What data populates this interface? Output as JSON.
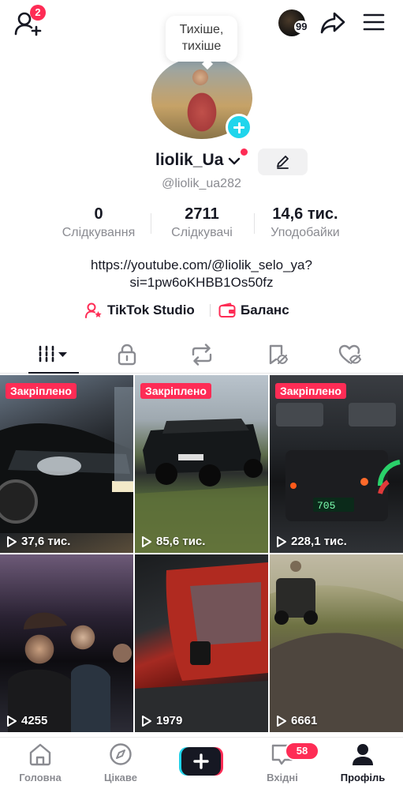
{
  "topbar": {
    "add_friends_badge": "2",
    "story_count": "99"
  },
  "avatar_bubble": {
    "line1": "Тихіше,",
    "line2": "тихіше"
  },
  "profile": {
    "username": "liolik_Ua",
    "handle": "@liolik_ua282"
  },
  "stats": [
    {
      "value": "0",
      "label": "Слідкування"
    },
    {
      "value": "2711",
      "label": "Слідкувачі"
    },
    {
      "value": "14,6 тис.",
      "label": "Уподобайки"
    }
  ],
  "bio": {
    "line1": "https://youtube.com/@liolik_selo_ya?",
    "line2": "si=1pw6oKHBB1Os50fz"
  },
  "links": {
    "studio": "TikTok Studio",
    "balance": "Баланс"
  },
  "tabs": [
    "videos-grid",
    "private",
    "reposts",
    "favorites",
    "liked"
  ],
  "videos": [
    {
      "pinned": "Закріплено",
      "views": "37,6 тис."
    },
    {
      "pinned": "Закріплено",
      "views": "85,6 тис."
    },
    {
      "pinned": "Закріплено",
      "views": "228,1 тис."
    },
    {
      "pinned": "",
      "views": "4255"
    },
    {
      "pinned": "",
      "views": "1979"
    },
    {
      "pinned": "",
      "views": "6661"
    }
  ],
  "bottom_nav": {
    "home": "Головна",
    "discover": "Цікаве",
    "inbox": "Вхідні",
    "inbox_badge": "58",
    "profile": "Профіль"
  },
  "colors": {
    "accent_red": "#fe2c55",
    "accent_cyan": "#20d5ec",
    "text_primary": "#161823",
    "text_secondary": "#8a8b91"
  }
}
